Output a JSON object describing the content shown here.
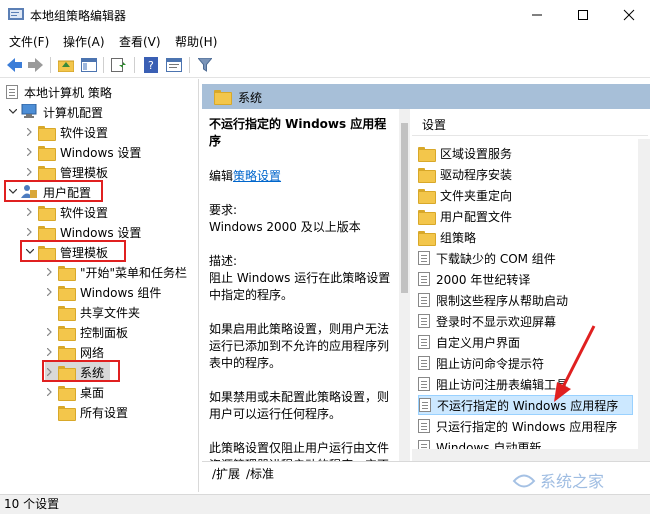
{
  "window": {
    "title": "本地组策略编辑器"
  },
  "menu": [
    "文件(F)",
    "操作(A)",
    "查看(V)",
    "帮助(H)"
  ],
  "tree": {
    "root": "本地计算机 策略",
    "computer_config": "计算机配置",
    "cc_children": [
      "软件设置",
      "Windows 设置",
      "管理模板"
    ],
    "user_config": "用户配置",
    "uc_children": [
      "软件设置",
      "Windows 设置"
    ],
    "admin_templates": "管理模板",
    "at_children": [
      "\"开始\"菜单和任务栏",
      "Windows 组件",
      "共享文件夹",
      "控制面板",
      "网络",
      "系统",
      "桌面",
      "所有设置"
    ]
  },
  "right": {
    "header_title": "系统",
    "policy_title": "不运行指定的 Windows 应用程序",
    "edit_prefix": "编辑",
    "edit_link": "策略设置",
    "requirement_label": "要求:",
    "requirement_value": "Windows 2000 及以上版本",
    "description_label": "描述:",
    "description_text": "阻止 Windows 运行在此策略设置中指定的程序。",
    "para_enabled": "如果启用此策略设置，则用户无法运行已添加到不允许的应用程序列表中的程序。",
    "para_disabled": "如果禁用或未配置此策略设置，则用户可以运行任何程序。",
    "para_note": "此策略设置仅阻止用户运行由文件资源管理器进程启动的程序。它不会阻止用户运行由系统进程或其他"
  },
  "list": {
    "header": "设置",
    "folders": [
      "区域设置服务",
      "驱动程序安装",
      "文件夹重定向",
      "用户配置文件",
      "组策略"
    ],
    "policies": [
      "下载缺少的 COM 组件",
      "2000 年世纪转译",
      "限制这些程序从帮助启动",
      "登录时不显示欢迎屏幕",
      "自定义用户界面",
      "阻止访问命令提示符",
      "阻止访问注册表编辑工具",
      "不运行指定的 Windows 应用程序",
      "只运行指定的 Windows 应用程序",
      "Windows 自动更新"
    ],
    "selected_index": 7
  },
  "tabs": [
    "扩展",
    "标准"
  ],
  "status": "10 个设置",
  "watermark": "系统之家",
  "colors": {
    "header": "#a7bfd8",
    "highlight": "#e02020",
    "selection": "#cce8ff",
    "link": "#0066cc"
  }
}
